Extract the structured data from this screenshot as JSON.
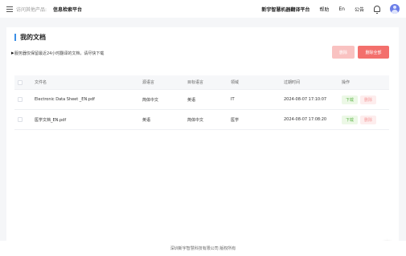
{
  "topbar": {
    "products_label": "访问其他产品:",
    "product_name": "信息检索平台",
    "platform_name": "新宇智慧机器翻译平台",
    "help": "帮助",
    "lang": "En",
    "announcement": "公告",
    "icons": {
      "menu": "menu-icon",
      "bell": "bell-icon",
      "avatar": "user-avatar"
    }
  },
  "main": {
    "title": "我的文档",
    "notice": "服务器仅保留最近24小时翻译的文档，请尽快下载",
    "delete_label": "删除",
    "delete_all_label": "删除全部",
    "colors": {
      "accent": "#3a8ee6",
      "danger": "#f36f6c",
      "danger_light": "#f9c2c1",
      "success": "#5fb54a"
    }
  },
  "table": {
    "headers": [
      "文件名",
      "源语言",
      "目标语言",
      "领域",
      "过期时间",
      "操作"
    ],
    "rows": [
      {
        "filename": "Electronic Data Sheet _EN.pdf",
        "source": "简体中文",
        "target": "英语",
        "domain": "IT",
        "expires": "2024-08-07 17:10:07",
        "download": "下载",
        "delete": "删除"
      },
      {
        "filename": "医学文档_EN.pdf",
        "source": "英语",
        "target": "简体中文",
        "domain": "医学",
        "expires": "2024-08-07 17:08:20",
        "download": "下载",
        "delete": "删除"
      }
    ]
  },
  "float_button": "译",
  "footer": "深圳新宇智慧科技有限公司 版权所有"
}
